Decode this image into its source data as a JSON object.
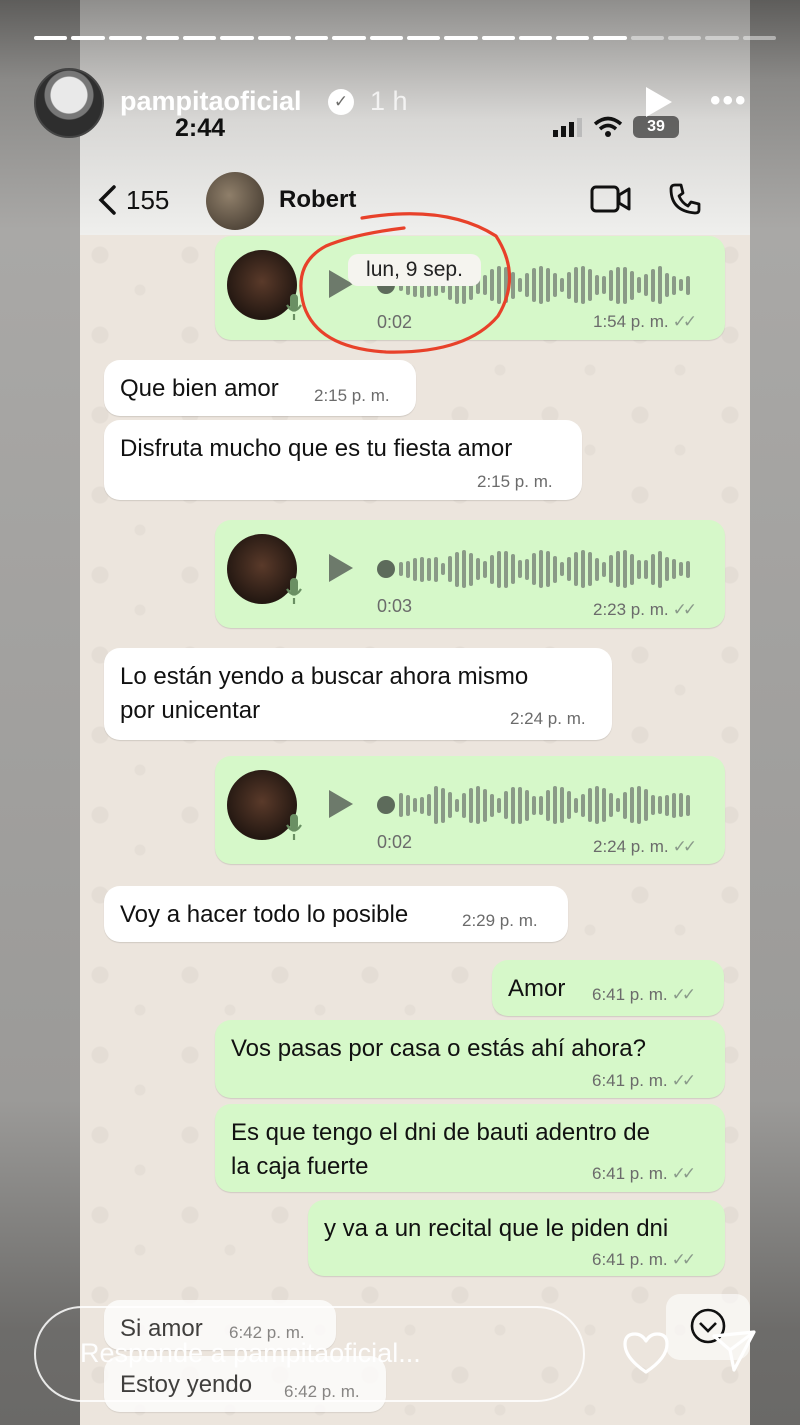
{
  "story": {
    "username": "pampitaoficial",
    "verified_mark": "✓",
    "time_ago": "1 h",
    "segments_total": 20,
    "segments_done": 16,
    "reply_placeholder": "Responde a pampitaoficial..."
  },
  "status_bar": {
    "time": "2:44",
    "battery": "39"
  },
  "chat_header": {
    "back_count": "155",
    "contact_name": "Robert"
  },
  "date_pill": "lun, 9 sep.",
  "messages": [
    {
      "type": "voice",
      "dir": "out",
      "duration": "0:02",
      "time": "1:54 p. m."
    },
    {
      "type": "text",
      "dir": "in",
      "text": "Que bien amor",
      "time": "2:15 p. m."
    },
    {
      "type": "text",
      "dir": "in",
      "text": "Disfruta mucho que es tu fiesta amor",
      "time": "2:15 p. m."
    },
    {
      "type": "voice",
      "dir": "out",
      "duration": "0:03",
      "time": "2:23 p. m."
    },
    {
      "type": "text",
      "dir": "in",
      "text": "Lo están yendo a buscar ahora mismo",
      "text2": "por unicentar",
      "time": "2:24 p. m."
    },
    {
      "type": "voice",
      "dir": "out",
      "duration": "0:02",
      "time": "2:24 p. m."
    },
    {
      "type": "text",
      "dir": "in",
      "text": "Voy a hacer todo lo posible",
      "time": "2:29 p. m."
    },
    {
      "type": "text",
      "dir": "out",
      "text": "Amor",
      "time": "6:41 p. m."
    },
    {
      "type": "text",
      "dir": "out",
      "text": "Vos pasas por casa o estás ahí ahora?",
      "time": "6:41 p. m."
    },
    {
      "type": "text",
      "dir": "out",
      "text": "Es que tengo el dni de bauti adentro de",
      "text2": "la caja fuerte",
      "time": "6:41 p. m."
    },
    {
      "type": "text",
      "dir": "out",
      "text": "y va a un recital que le piden dni",
      "time": "6:41 p. m."
    },
    {
      "type": "text",
      "dir": "in",
      "text": "Si amor",
      "time": "6:42 p. m."
    },
    {
      "type": "text",
      "dir": "in",
      "text": "Estoy yendo",
      "time": "6:42 p. m."
    }
  ],
  "ticks": "✓✓",
  "icons": [
    "back-chevron-icon",
    "video-call-icon",
    "phone-call-icon",
    "mic-icon",
    "play-icon",
    "heart-icon",
    "send-icon",
    "more-icon",
    "verified-icon",
    "chevron-down-icon"
  ],
  "colors": {
    "outgoing": "#d6f8c9",
    "incoming": "#ffffff",
    "chat_bg": "#ece5dd",
    "annotation": "#e8412a"
  }
}
